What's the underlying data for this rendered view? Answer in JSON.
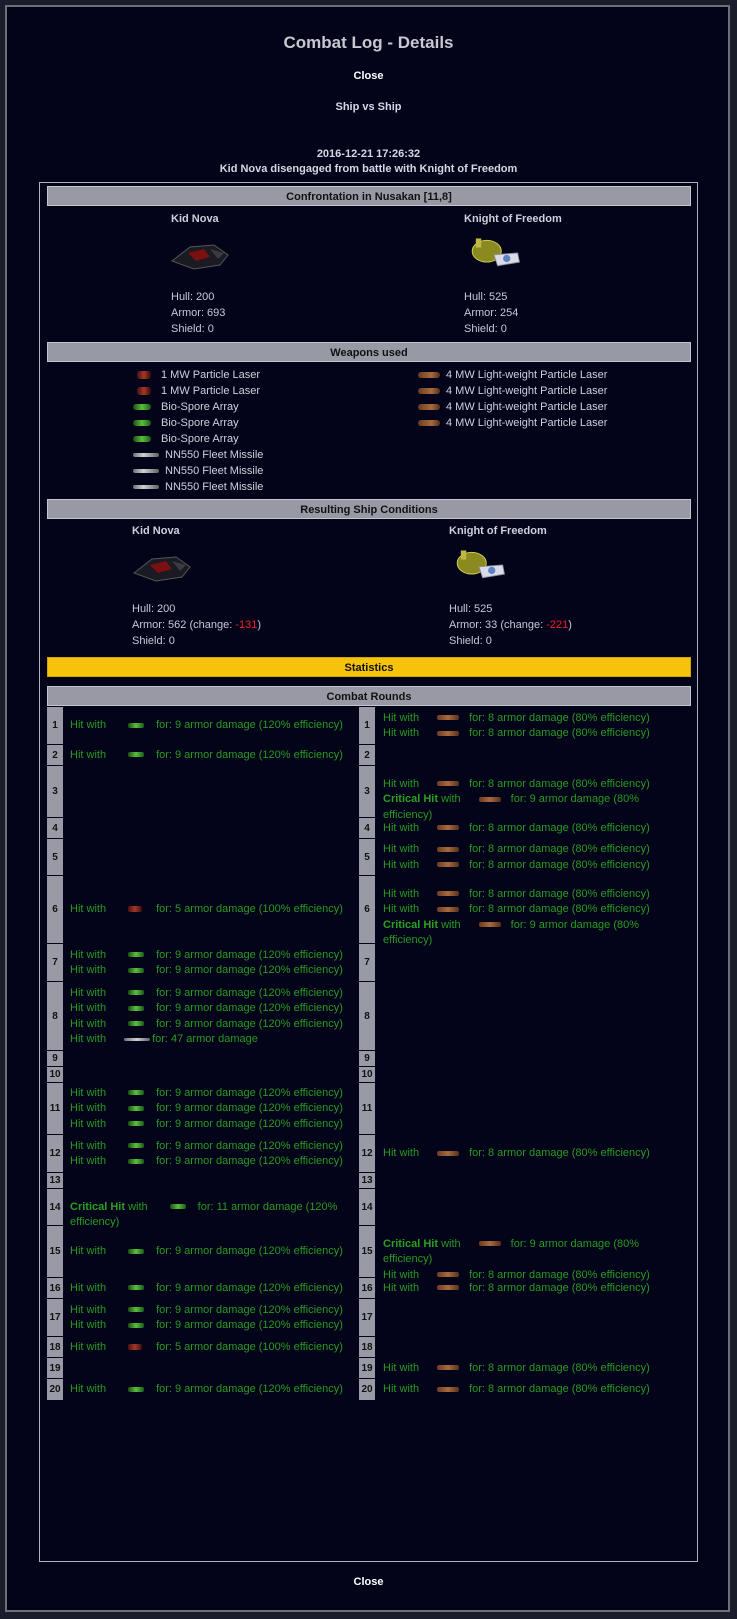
{
  "page": {
    "title": "Combat Log - Details",
    "close_label": "Close",
    "mode": "Ship vs Ship",
    "timestamp": "2016-12-21 17:26:32",
    "summary": "Kid Nova disengaged from battle with Knight of Freedom"
  },
  "confrontation": {
    "header": "Confrontation in Nusakan [11,8]",
    "left": {
      "name": "Kid Nova",
      "hull": "Hull: 200",
      "armor": "Armor: 693",
      "shield": "Shield: 0"
    },
    "right": {
      "name": "Knight of Freedom",
      "hull": "Hull: 525",
      "armor": "Armor: 254",
      "shield": "Shield: 0"
    }
  },
  "weapons": {
    "header": "Weapons used",
    "left": [
      {
        "icon": "particle-laser-icon",
        "label": "1 MW Particle Laser"
      },
      {
        "icon": "particle-laser-icon",
        "label": "1 MW Particle Laser"
      },
      {
        "icon": "bio-spore-icon",
        "label": "Bio-Spore Array"
      },
      {
        "icon": "bio-spore-icon",
        "label": "Bio-Spore Array"
      },
      {
        "icon": "bio-spore-icon",
        "label": "Bio-Spore Array"
      },
      {
        "icon": "missile-icon",
        "label": "NN550 Fleet Missile"
      },
      {
        "icon": "missile-icon",
        "label": "NN550 Fleet Missile"
      },
      {
        "icon": "missile-icon",
        "label": "NN550 Fleet Missile"
      }
    ],
    "right": [
      {
        "icon": "lw-particle-laser-icon",
        "label": "4 MW Light-weight Particle Laser"
      },
      {
        "icon": "lw-particle-laser-icon",
        "label": "4 MW Light-weight Particle Laser"
      },
      {
        "icon": "lw-particle-laser-icon",
        "label": "4 MW Light-weight Particle Laser"
      },
      {
        "icon": "lw-particle-laser-icon",
        "label": "4 MW Light-weight Particle Laser"
      }
    ]
  },
  "result": {
    "header": "Resulting Ship Conditions",
    "left": {
      "name": "Kid Nova",
      "hull": "Hull: 200",
      "armor_prefix": "Armor: 562 (change: ",
      "armor_change": "-131",
      "armor_suffix": ")",
      "shield": "Shield: 0"
    },
    "right": {
      "name": "Knight of Freedom",
      "hull": "Hull: 525",
      "armor_prefix": "Armor: 33 (change: ",
      "armor_change": "-221",
      "armor_suffix": ")",
      "shield": "Shield: 0"
    }
  },
  "statistics": {
    "label": "Statistics"
  },
  "rounds_header": "Combat Rounds",
  "strings": {
    "hit": "Hit with",
    "crit": "Critical Hit",
    "with": "with",
    "bio": "for: 9 armor damage (120% efficiency)",
    "lw": "for: 8 armor damage (80% efficiency)",
    "lwcrit": "for: 9 armor damage (80% efficiency)",
    "laser": "for: 5 armor damage (100% efficiency)",
    "missile": "for: 47 armor damage",
    "biocrit": "for: 11 armor damage (120% efficiency)"
  },
  "rounds": [
    {
      "n": "1",
      "left": [
        [
          "hit",
          "bio",
          "bio"
        ]
      ],
      "right": [
        [
          "hit",
          "lw",
          "lw"
        ],
        [
          "hit",
          "lw",
          "lw"
        ]
      ]
    },
    {
      "n": "2",
      "left": [
        [
          "hit",
          "bio",
          "bio"
        ]
      ],
      "right": []
    },
    {
      "n": "3",
      "left": [],
      "right": [
        [
          "hit",
          "lw",
          "lw"
        ],
        [
          "crit",
          "lw",
          "lwcrit"
        ]
      ]
    },
    {
      "n": "4",
      "left": [],
      "right": [
        [
          "hit",
          "lw",
          "lw"
        ]
      ]
    },
    {
      "n": "5",
      "left": [],
      "right": [
        [
          "hit",
          "lw",
          "lw"
        ],
        [
          "hit",
          "lw",
          "lw"
        ]
      ]
    },
    {
      "n": "6",
      "left": [
        [
          "hit",
          "laser",
          "laser"
        ]
      ],
      "right": [
        [
          "hit",
          "lw",
          "lw"
        ],
        [
          "hit",
          "lw",
          "lw"
        ],
        [
          "crit",
          "lw",
          "lwcrit"
        ]
      ]
    },
    {
      "n": "7",
      "left": [
        [
          "hit",
          "bio",
          "bio"
        ],
        [
          "hit",
          "bio",
          "bio"
        ]
      ],
      "right": []
    },
    {
      "n": "8",
      "left": [
        [
          "hit",
          "bio",
          "bio"
        ],
        [
          "hit",
          "bio",
          "bio"
        ],
        [
          "hit",
          "bio",
          "bio"
        ],
        [
          "hit",
          "missile",
          "missile"
        ]
      ],
      "right": []
    },
    {
      "n": "9",
      "left": [],
      "right": []
    },
    {
      "n": "10",
      "left": [],
      "right": []
    },
    {
      "n": "11",
      "left": [
        [
          "hit",
          "bio",
          "bio"
        ],
        [
          "hit",
          "bio",
          "bio"
        ],
        [
          "hit",
          "bio",
          "bio"
        ]
      ],
      "right": []
    },
    {
      "n": "12",
      "left": [
        [
          "hit",
          "bio",
          "bio"
        ],
        [
          "hit",
          "bio",
          "bio"
        ]
      ],
      "right": [
        [
          "hit",
          "lw",
          "lw"
        ]
      ]
    },
    {
      "n": "13",
      "left": [],
      "right": []
    },
    {
      "n": "14",
      "left": [
        [
          "crit",
          "bio",
          "biocrit"
        ]
      ],
      "right": []
    },
    {
      "n": "15",
      "left": [
        [
          "hit",
          "bio",
          "bio"
        ]
      ],
      "right": [
        [
          "crit",
          "lw",
          "lwcrit"
        ],
        [
          "hit",
          "lw",
          "lw"
        ]
      ]
    },
    {
      "n": "16",
      "left": [
        [
          "hit",
          "bio",
          "bio"
        ]
      ],
      "right": [
        [
          "hit",
          "lw",
          "lw"
        ]
      ]
    },
    {
      "n": "17",
      "left": [
        [
          "hit",
          "bio",
          "bio"
        ],
        [
          "hit",
          "bio",
          "bio"
        ]
      ],
      "right": []
    },
    {
      "n": "18",
      "left": [
        [
          "hit",
          "laser",
          "laser"
        ]
      ],
      "right": []
    },
    {
      "n": "19",
      "left": [],
      "right": [
        [
          "hit",
          "lw",
          "lw"
        ]
      ]
    },
    {
      "n": "20",
      "left": [
        [
          "hit",
          "bio",
          "bio"
        ]
      ],
      "right": [
        [
          "hit",
          "lw",
          "lw"
        ]
      ]
    }
  ]
}
